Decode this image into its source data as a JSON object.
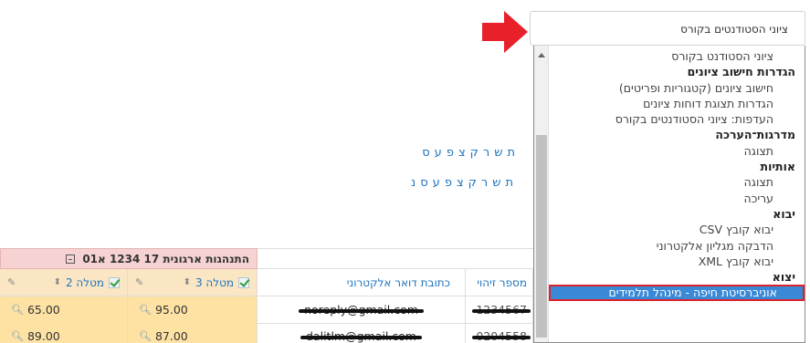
{
  "letters_row1": [
    "ת",
    "ש",
    "ר",
    "ק",
    "צ",
    "פ",
    "ע",
    "ס"
  ],
  "letters_row2": [
    "ת",
    "ש",
    "ר",
    "ק",
    "צ",
    "פ",
    "ע",
    "ס",
    "נ"
  ],
  "select": {
    "value": "ציוני הסטודנטים בקורס"
  },
  "dropdown": {
    "options": [
      {
        "type": "item",
        "label": "ציוני הסטודנט בקורס"
      },
      {
        "type": "group",
        "label": "הגדרות חישוב ציונים"
      },
      {
        "type": "item",
        "label": "חישוב ציונים (קטגוריות ופריטים)"
      },
      {
        "type": "item",
        "label": "הגדרות תצוגת דוחות ציונים"
      },
      {
        "type": "item",
        "label": "העדפות: ציוני הסטודנטים בקורס"
      },
      {
        "type": "group",
        "label": "מדרגות־הערכה"
      },
      {
        "type": "item",
        "label": "תצוגה"
      },
      {
        "type": "group",
        "label": "אותיות"
      },
      {
        "type": "item",
        "label": "תצוגה"
      },
      {
        "type": "item",
        "label": "עריכה"
      },
      {
        "type": "group",
        "label": "יבוא"
      },
      {
        "type": "item",
        "label": "יבוא קובץ CSV"
      },
      {
        "type": "item",
        "label": "הדבקה מגליון אלקטרוני"
      },
      {
        "type": "item",
        "label": "יבוא קובץ XML"
      },
      {
        "type": "group",
        "label": "יצוא"
      },
      {
        "type": "selected",
        "label": "אוניברסיטת חיפה - מינהל תלמידים"
      }
    ]
  },
  "table": {
    "category_header": "התנהגות ארגונית 17 1234 א01",
    "columns": {
      "task2": "מטלה 2",
      "task3": "מטלה 3",
      "email": "כתובת דואר אלקטרוני",
      "id": "מספר זיהוי"
    },
    "rows": [
      {
        "task2": "65.00",
        "task3": "95.00",
        "email": "noreply@gmail.com",
        "id": "1234567"
      },
      {
        "task2": "89.00",
        "task3": "87.00",
        "email": "dalitlm@gmail.com",
        "id": "0204558"
      }
    ]
  },
  "colors": {
    "accent": "#1e73be",
    "selected_bg": "#3a89d6",
    "highlight_outline": "#e0222a",
    "category_bg": "#f6d2d2",
    "grade_bg": "#fde2a4"
  },
  "icons": {
    "arrow": "red-arrow-right-icon",
    "magnifier": "magnifier-icon",
    "check": "checkbox-checked-icon",
    "sort": "sort-arrows-icon",
    "edit": "pencil-icon",
    "collapse": "collapse-minus-icon"
  }
}
